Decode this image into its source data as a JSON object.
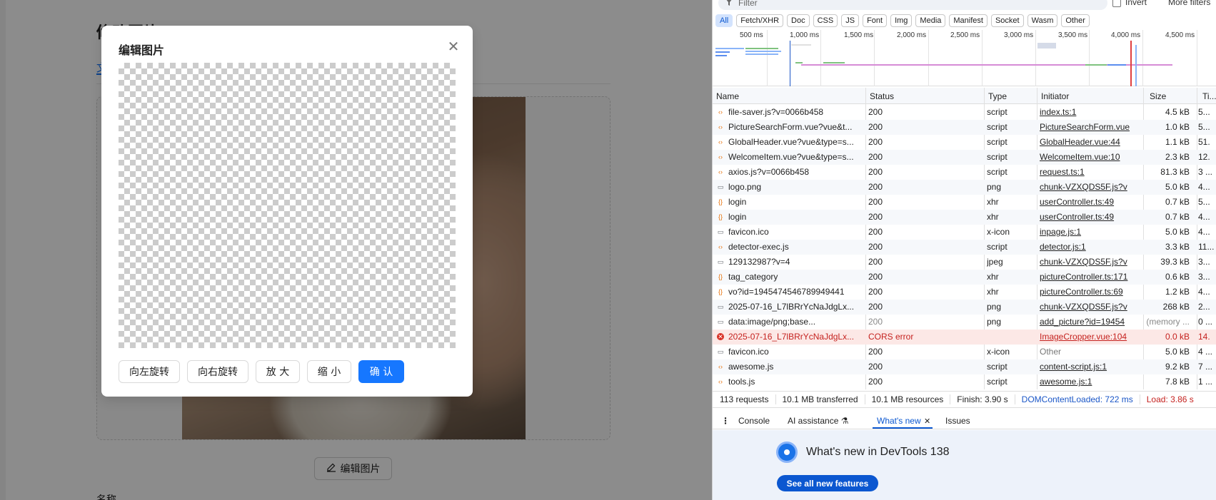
{
  "app": {
    "page_title": "修改图片",
    "tab_label": "文",
    "edit_button_label": "编辑图片",
    "field_label": "名称"
  },
  "modal": {
    "title": "编辑图片",
    "close_glyph": "✕",
    "buttons": {
      "rotate_left": "向左旋转",
      "rotate_right": "向右旋转",
      "zoom_in": "放 大",
      "zoom_out": "缩 小",
      "confirm": "确 认"
    },
    "primary_color": "#1677ff"
  },
  "devtools": {
    "filter_placeholder": "Filter",
    "invert_label": "Invert",
    "more_filters_label": "More filters",
    "type_filters": [
      "All",
      "Fetch/XHR",
      "Doc",
      "CSS",
      "JS",
      "Font",
      "Img",
      "Media",
      "Manifest",
      "Socket",
      "Wasm",
      "Other"
    ],
    "overview_ticks": [
      "500 ms",
      "1,000 ms",
      "1,500 ms",
      "2,000 ms",
      "2,500 ms",
      "3,000 ms",
      "3,500 ms",
      "4,000 ms",
      "4,500 ms"
    ],
    "columns": [
      "Name",
      "Status",
      "Type",
      "Initiator",
      "Size",
      "Ti..."
    ],
    "rows": [
      {
        "icon": "script-icon",
        "name": "file-saver.js?v=0066b458",
        "status": "200",
        "type": "script",
        "initiator": "index.ts:1",
        "size": "4.5 kB",
        "time": "5..."
      },
      {
        "icon": "script-icon",
        "name": "PictureSearchForm.vue?vue&t...",
        "status": "200",
        "type": "script",
        "initiator": "PictureSearchForm.vue",
        "size": "1.0 kB",
        "time": "5..."
      },
      {
        "icon": "script-icon",
        "name": "GlobalHeader.vue?vue&type=s...",
        "status": "200",
        "type": "script",
        "initiator": "GlobalHeader.vue:44",
        "size": "1.1 kB",
        "time": "51."
      },
      {
        "icon": "script-icon",
        "name": "WelcomeItem.vue?vue&type=s...",
        "status": "200",
        "type": "script",
        "initiator": "WelcomeItem.vue:10",
        "size": "2.3 kB",
        "time": "12."
      },
      {
        "icon": "script-icon",
        "name": "axios.js?v=0066b458",
        "status": "200",
        "type": "script",
        "initiator": "request.ts:1",
        "size": "81.3 kB",
        "time": "3 ..."
      },
      {
        "icon": "image-icon",
        "name": "logo.png",
        "status": "200",
        "type": "png",
        "initiator": "chunk-VZXQDS5F.js?v",
        "size": "5.0 kB",
        "time": "4..."
      },
      {
        "icon": "xhr-icon",
        "name": "login",
        "status": "200",
        "type": "xhr",
        "initiator": "userController.ts:49",
        "size": "0.7 kB",
        "time": "5..."
      },
      {
        "icon": "xhr-icon",
        "name": "login",
        "status": "200",
        "type": "xhr",
        "initiator": "userController.ts:49",
        "size": "0.7 kB",
        "time": "4..."
      },
      {
        "icon": "image-icon",
        "name": "favicon.ico",
        "status": "200",
        "type": "x-icon",
        "initiator": "inpage.js:1",
        "size": "5.0 kB",
        "time": "4..."
      },
      {
        "icon": "script-icon",
        "name": "detector-exec.js",
        "status": "200",
        "type": "script",
        "initiator": "detector.js:1",
        "size": "3.3 kB",
        "time": "11..."
      },
      {
        "icon": "image-icon",
        "name": "129132987?v=4",
        "status": "200",
        "type": "jpeg",
        "initiator": "chunk-VZXQDS5F.js?v",
        "size": "39.3 kB",
        "time": "3..."
      },
      {
        "icon": "xhr-icon",
        "name": "tag_category",
        "status": "200",
        "type": "xhr",
        "initiator": "pictureController.ts:171",
        "size": "0.6 kB",
        "time": "3..."
      },
      {
        "icon": "xhr-icon",
        "name": "vo?id=1945474546789949441",
        "status": "200",
        "type": "xhr",
        "initiator": "pictureController.ts:69",
        "size": "1.2 kB",
        "time": "4..."
      },
      {
        "icon": "image-icon",
        "name": "2025-07-16_L7lBRrYcNaJdgLx...",
        "status": "200",
        "type": "png",
        "initiator": "chunk-VZXQDS5F.js?v",
        "size": "268 kB",
        "time": "2..."
      },
      {
        "icon": "image-icon",
        "name": "data:image/png;base...",
        "status": "200",
        "type": "png",
        "initiator": "add_picture?id=19454",
        "size": "(memory ...",
        "time": "0 ..."
      },
      {
        "icon": "error-icon",
        "name": "2025-07-16_L7lBRrYcNaJdgLx...",
        "status": "CORS error",
        "type": "",
        "initiator": "ImageCropper.vue:104",
        "size": "0.0 kB",
        "time": "14."
      },
      {
        "icon": "image-icon",
        "name": "favicon.ico",
        "status": "200",
        "type": "x-icon",
        "initiator": "Other",
        "size": "5.0 kB",
        "time": "4 ..."
      },
      {
        "icon": "script-icon",
        "name": "awesome.js",
        "status": "200",
        "type": "script",
        "initiator": "content-script.js:1",
        "size": "9.2 kB",
        "time": "7 ..."
      },
      {
        "icon": "script-icon",
        "name": "tools.js",
        "status": "200",
        "type": "script",
        "initiator": "awesome.js:1",
        "size": "7.8 kB",
        "time": "1 ..."
      }
    ],
    "summary": {
      "requests": "113 requests",
      "transferred": "10.1 MB transferred",
      "resources": "10.1 MB resources",
      "finish": "Finish: 3.90 s",
      "dom_loaded": "DOMContentLoaded: 722 ms",
      "load": "Load: 3.86 s"
    },
    "drawer_tabs": {
      "menu": "⋮",
      "console": "Console",
      "ai": "AI assistance ⚗",
      "whats_new": "What's new",
      "close": "✕",
      "issues": "Issues"
    },
    "whats_new": {
      "title": "What's new in DevTools 138",
      "button": "See all new features"
    },
    "colors": {
      "selected_tab": "#0b57d0",
      "error_row": "#fce8e6",
      "error_text": "#c5221f"
    }
  }
}
